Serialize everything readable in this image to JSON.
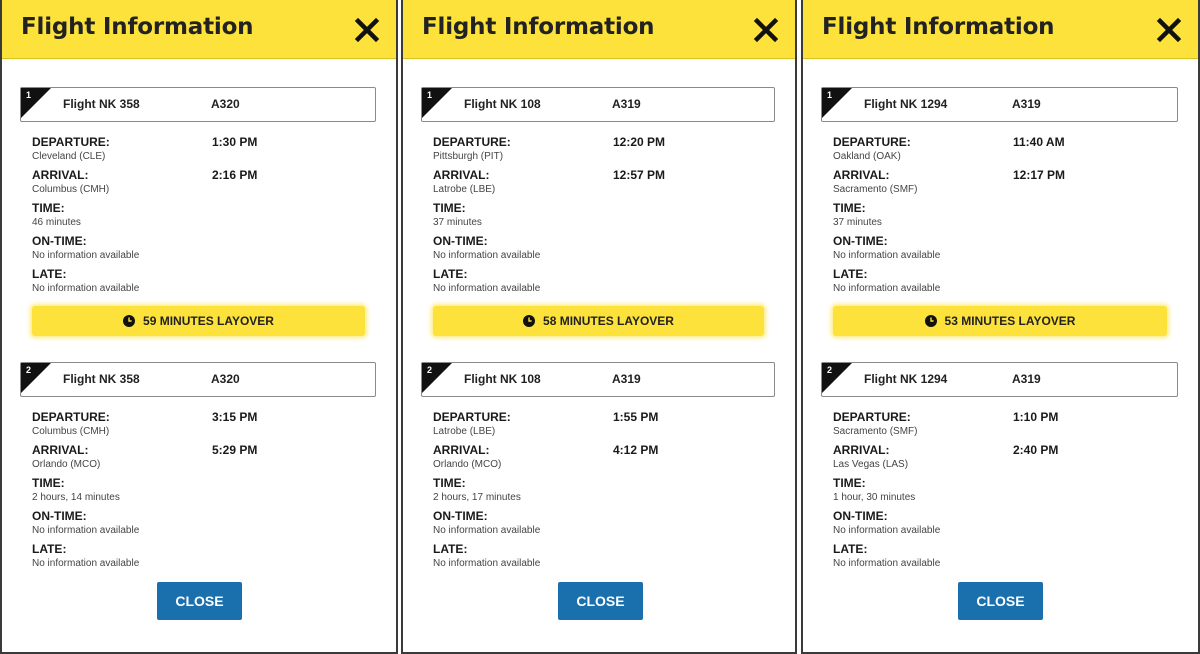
{
  "panels": [
    {
      "title": "Flight Information",
      "segments": [
        {
          "number": "1",
          "flight": "Flight NK 358",
          "aircraft": "A320",
          "departure_label": "DEPARTURE:",
          "departure_city": "Cleveland (CLE)",
          "departure_time": "1:30 PM",
          "arrival_label": "ARRIVAL:",
          "arrival_city": "Columbus (CMH)",
          "arrival_time": "2:16 PM",
          "time_label": "TIME:",
          "time_value": "46 minutes",
          "ontime_label": "ON-TIME:",
          "ontime_value": "No information available",
          "late_label": "LATE:",
          "late_value": "No information available"
        },
        {
          "number": "2",
          "flight": "Flight NK 358",
          "aircraft": "A320",
          "departure_label": "DEPARTURE:",
          "departure_city": "Columbus (CMH)",
          "departure_time": "3:15 PM",
          "arrival_label": "ARRIVAL:",
          "arrival_city": "Orlando (MCO)",
          "arrival_time": "5:29 PM",
          "time_label": "TIME:",
          "time_value": "2 hours, 14 minutes",
          "ontime_label": "ON-TIME:",
          "ontime_value": "No information available",
          "late_label": "LATE:",
          "late_value": "No information available"
        }
      ],
      "layover": "59 MINUTES LAYOVER",
      "close_label": "CLOSE"
    },
    {
      "title": "Flight Information",
      "segments": [
        {
          "number": "1",
          "flight": "Flight NK 108",
          "aircraft": "A319",
          "departure_label": "DEPARTURE:",
          "departure_city": "Pittsburgh (PIT)",
          "departure_time": "12:20 PM",
          "arrival_label": "ARRIVAL:",
          "arrival_city": "Latrobe (LBE)",
          "arrival_time": "12:57 PM",
          "time_label": "TIME:",
          "time_value": "37 minutes",
          "ontime_label": "ON-TIME:",
          "ontime_value": "No information available",
          "late_label": "LATE:",
          "late_value": "No information available"
        },
        {
          "number": "2",
          "flight": "Flight NK 108",
          "aircraft": "A319",
          "departure_label": "DEPARTURE:",
          "departure_city": "Latrobe (LBE)",
          "departure_time": "1:55 PM",
          "arrival_label": "ARRIVAL:",
          "arrival_city": "Orlando (MCO)",
          "arrival_time": "4:12 PM",
          "time_label": "TIME:",
          "time_value": "2 hours, 17 minutes",
          "ontime_label": "ON-TIME:",
          "ontime_value": "No information available",
          "late_label": "LATE:",
          "late_value": "No information available"
        }
      ],
      "layover": "58 MINUTES LAYOVER",
      "close_label": "CLOSE"
    },
    {
      "title": "Flight Information",
      "segments": [
        {
          "number": "1",
          "flight": "Flight NK 1294",
          "aircraft": "A319",
          "departure_label": "DEPARTURE:",
          "departure_city": "Oakland (OAK)",
          "departure_time": "11:40 AM",
          "arrival_label": "ARRIVAL:",
          "arrival_city": "Sacramento (SMF)",
          "arrival_time": "12:17 PM",
          "time_label": "TIME:",
          "time_value": "37 minutes",
          "ontime_label": "ON-TIME:",
          "ontime_value": "No information available",
          "late_label": "LATE:",
          "late_value": "No information available"
        },
        {
          "number": "2",
          "flight": "Flight NK 1294",
          "aircraft": "A319",
          "departure_label": "DEPARTURE:",
          "departure_city": "Sacramento (SMF)",
          "departure_time": "1:10 PM",
          "arrival_label": "ARRIVAL:",
          "arrival_city": "Las Vegas (LAS)",
          "arrival_time": "2:40 PM",
          "time_label": "TIME:",
          "time_value": "1 hour, 30 minutes",
          "ontime_label": "ON-TIME:",
          "ontime_value": "No information available",
          "late_label": "LATE:",
          "late_value": "No information available"
        }
      ],
      "layover": "53 MINUTES LAYOVER",
      "close_label": "CLOSE"
    }
  ],
  "colors": {
    "header_yellow": "#fde23b",
    "close_button_blue": "#1a6fad",
    "text_dark": "#1a1a1a"
  },
  "icons": {
    "close": "close-x-icon",
    "layover": "clock-icon"
  }
}
